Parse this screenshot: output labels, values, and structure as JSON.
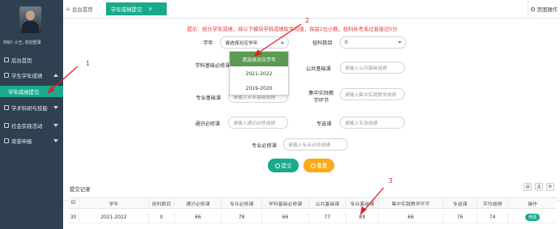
{
  "sidebar": {
    "greeting": "你好! 小王, 欢迎登录",
    "items": [
      {
        "label": "后台首页",
        "icon": "home-icon"
      },
      {
        "label": "学生学年成绩",
        "icon": "grid-icon"
      },
      {
        "label": "学年成绩提交",
        "icon": ""
      },
      {
        "label": "学术科研与技能",
        "icon": "book-icon"
      },
      {
        "label": "社会实践活动",
        "icon": "users-icon"
      },
      {
        "label": "荣誉申报",
        "icon": "award-icon"
      }
    ]
  },
  "tabs": {
    "home": "后台首页",
    "current": "学年成绩提交",
    "page_op": "页面操作"
  },
  "form": {
    "tip": "提示：统计学年成绩，将以下模块学科成绩取平均值，保留2位小数，挂科补考未过直接记0分",
    "year_label": "学年",
    "year_value": "请选择对应学年",
    "fail_label": "挂科数目",
    "fail_value": "0",
    "base_required_label": "学科基础必修课",
    "public_base_label": "公共基础课",
    "public_base_placeholder": "请输入公共基础成绩",
    "major_base_label": "专业基础课",
    "major_base_placeholder": "请输入专业基础成绩",
    "practice_label": "集中实践教学环节",
    "practice_placeholder": "请输入集中实践教学成绩",
    "general_label": "通识必修课",
    "general_placeholder": "请输入通识必修成绩",
    "elective_label": "专选课",
    "elective_placeholder": "请输入专选成绩",
    "major_required_label": "专业必修课",
    "major_required_placeholder": "请输入专业必修成绩",
    "submit": "提交",
    "reset": "重置",
    "year_options": [
      "请选择对应学年",
      "2021-2022",
      "2019-2020"
    ]
  },
  "records": {
    "title": "提交记录",
    "columns": [
      "ID",
      "学年",
      "挂科数目",
      "通识必修课",
      "专业必修课",
      "学科基础必修课",
      "公共基础课",
      "专业基础课",
      "集中实践教学环节",
      "专选课",
      "平均成绩",
      "操作"
    ],
    "rows": [
      [
        "30",
        "2021-2022",
        "0",
        "66",
        "78",
        "66",
        "77",
        "89",
        "66",
        "76",
        "74",
        "修改"
      ]
    ]
  },
  "annotations": [
    "1",
    "2",
    "3"
  ],
  "colors": {
    "accent": "#19aa8d",
    "sidebar": "#2f4050",
    "warning": "#f8ac1a",
    "annotation": "#e02020"
  }
}
